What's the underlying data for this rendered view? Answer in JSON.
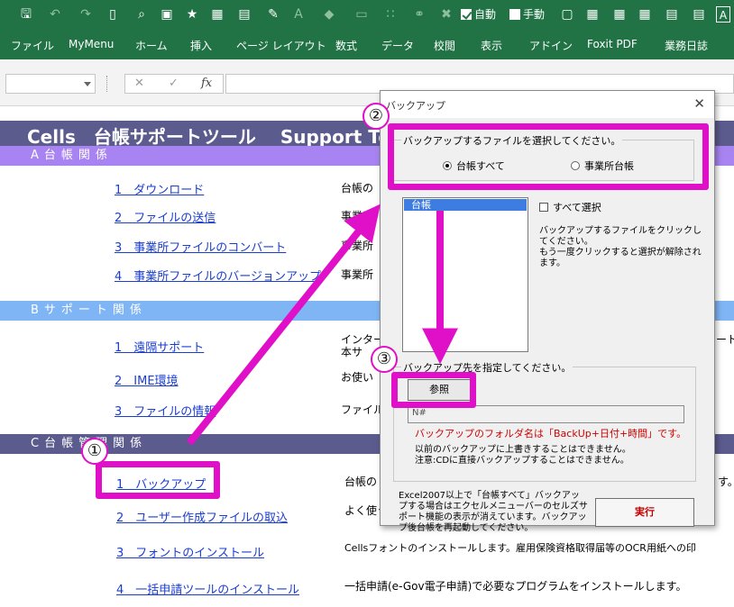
{
  "toolbar": {
    "auto_label": "自動",
    "manual_label": "手動",
    "auto_checked": true,
    "manual_checked": false
  },
  "ribbon_tabs": [
    "ファイル",
    "MyMenu",
    "ホーム",
    "挿入",
    "ページ レイアウト",
    "数式",
    "データ",
    "校閲",
    "表示",
    "アドイン",
    "Foxit PDF",
    "業務日誌"
  ],
  "formula_bar": {
    "name_box": "",
    "cancel": "✕",
    "enter": "✓",
    "fx": "fx",
    "value": ""
  },
  "sheet": {
    "title": "Cells　台帳サポートツール　 Support Tools",
    "section_a": "A台帳関係",
    "section_b": "Bサポート関係",
    "section_c": "C台帳管理関係",
    "links_a": [
      "1　ダウンロード",
      "2　ファイルの送信",
      "3　事業所ファイルのコンバート",
      "4　事業所ファイルのバージョンアップ"
    ],
    "desc_a": [
      "台帳の",
      "事業所",
      "事業所",
      "事業所"
    ],
    "links_b": [
      "1　遠隔サポート",
      "2　IME環境",
      "3　ファイルの情報"
    ],
    "desc_b": [
      "インター",
      "本サ",
      "お使い",
      "ファイル"
    ],
    "desc_b_right": "ート",
    "links_c": [
      "1　バックアップ",
      "2　ユーザー作成ファイルの取込",
      "3　フォントのインストール",
      "4　一括申請ツールのインストール"
    ],
    "desc_c": [
      "台帳の",
      "よく使う",
      "Cellsフォントのインストールします。雇用保険資格取得届等のOCR用紙への印",
      "一括申請(e-Gov電子申請)で必要なプログラムをインストールします。"
    ],
    "desc_c_right": "す。"
  },
  "dialog": {
    "title": "バックアップ",
    "close": "✕",
    "group1_label": "バックアップするファイルを選択してください。",
    "radio_all": "台帳すべて",
    "radio_office": "事業所台帳",
    "list_items": [
      "台帳"
    ],
    "select_all": "すべて選択",
    "hint1": "バックアップするファイルをクリックしてください。",
    "hint2": "もう一度クリックすると選択が解除されます。",
    "group2_label": "バックアップ先を指定してください。",
    "browse": "参照",
    "path_value": "N#",
    "folder_note": "バックアップのフォルダ名は「BackUp+日付+時間」です。",
    "overwrite_note": "以前のバックアップに上書きすることはできません。",
    "cd_note": "注意:CDに直接バックアップすることはできません。",
    "bottom_note": "Excel2007以上で「台帳すべて」バックアップする場合はエクセルメニューバーのセルズサポート機能の表示が消えています。バックアップ後台帳を再起動してください。",
    "execute": "実行"
  },
  "annotations": {
    "badge1": "①",
    "badge2": "②",
    "badge3": "③",
    "accent_color": "#e010c8"
  },
  "colors": {
    "excel_green": "#217346",
    "title_bar": "#5b5b8e",
    "section_a": "#a884f2",
    "section_b": "#7fb5f5",
    "link": "#1a3dd0"
  }
}
